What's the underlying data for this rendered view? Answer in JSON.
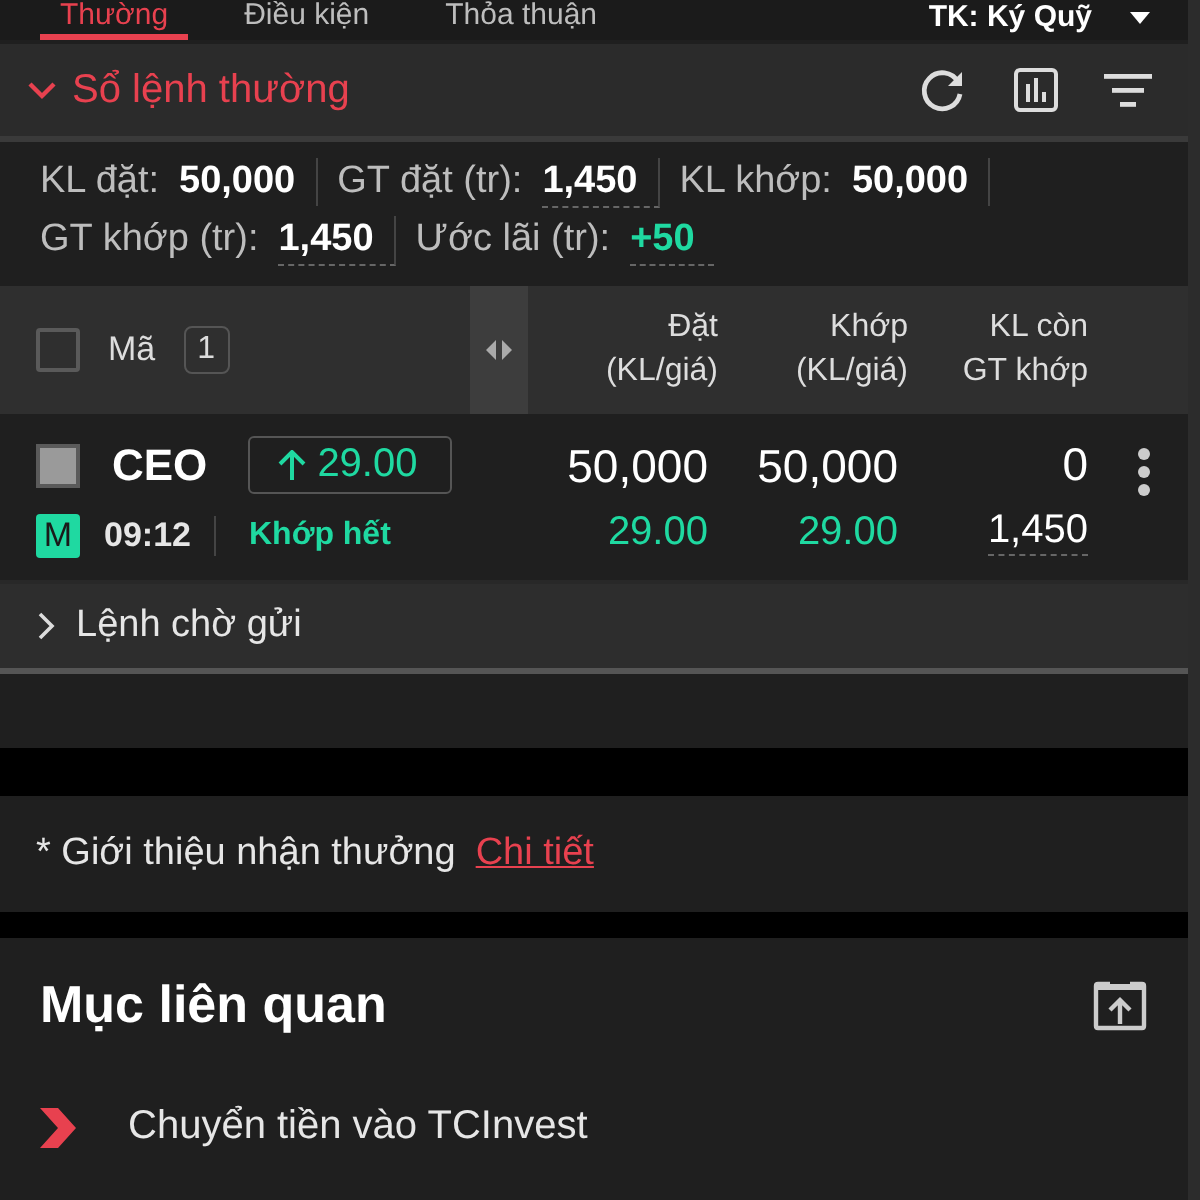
{
  "tabs": [
    {
      "label": "Thường",
      "selected": true
    },
    {
      "label": "Điều kiện",
      "selected": false
    },
    {
      "label": "Thỏa thuận",
      "selected": false
    }
  ],
  "account": {
    "label": "TK: Ký Quỹ"
  },
  "order_book": {
    "title": "Sổ lệnh thường",
    "expanded": true
  },
  "summary": [
    {
      "label": "KL đặt:",
      "value": "50,000",
      "color": "#ffffff",
      "underlined": false
    },
    {
      "label": "GT đặt (tr):",
      "value": "1,450",
      "color": "#ffffff",
      "underlined": true
    },
    {
      "label": "KL khớp:",
      "value": "50,000",
      "color": "#ffffff",
      "underlined": false
    },
    {
      "label": "GT khớp (tr):",
      "value": "1,450",
      "color": "#ffffff",
      "underlined": true
    },
    {
      "label": "Ước lãi (tr):",
      "value": "+50",
      "color": "#1fd9a1",
      "underlined": true
    }
  ],
  "table": {
    "select_all": {
      "checked": false
    },
    "symbol_header": "Mã",
    "count": "1",
    "columns": [
      {
        "line1": "Đặt",
        "line2": "(KL/giá)"
      },
      {
        "line1": "Khớp",
        "line2": "(KL/giá)"
      },
      {
        "line1": "KL còn",
        "line2": "GT khớp"
      }
    ],
    "rows": [
      {
        "checked": false,
        "symbol": "CEO",
        "price": "29.00",
        "rising": true,
        "badge": "M",
        "time": "09:12",
        "status": "Khớp hết",
        "ordered_volume": "50,000",
        "ordered_price": "29.00",
        "matched_volume": "50,000",
        "matched_price": "29.00",
        "remaining": "0",
        "matched_value": "1,450"
      }
    ]
  },
  "pending": {
    "label": "Lệnh chờ gửi",
    "expanded": false
  },
  "promo": {
    "text": "* Giới thiệu nhận thưởng",
    "link": "Chi tiết"
  },
  "related": {
    "title": "Mục liên quan",
    "items": [
      {
        "label": "Chuyển tiền vào TCInvest"
      }
    ]
  }
}
